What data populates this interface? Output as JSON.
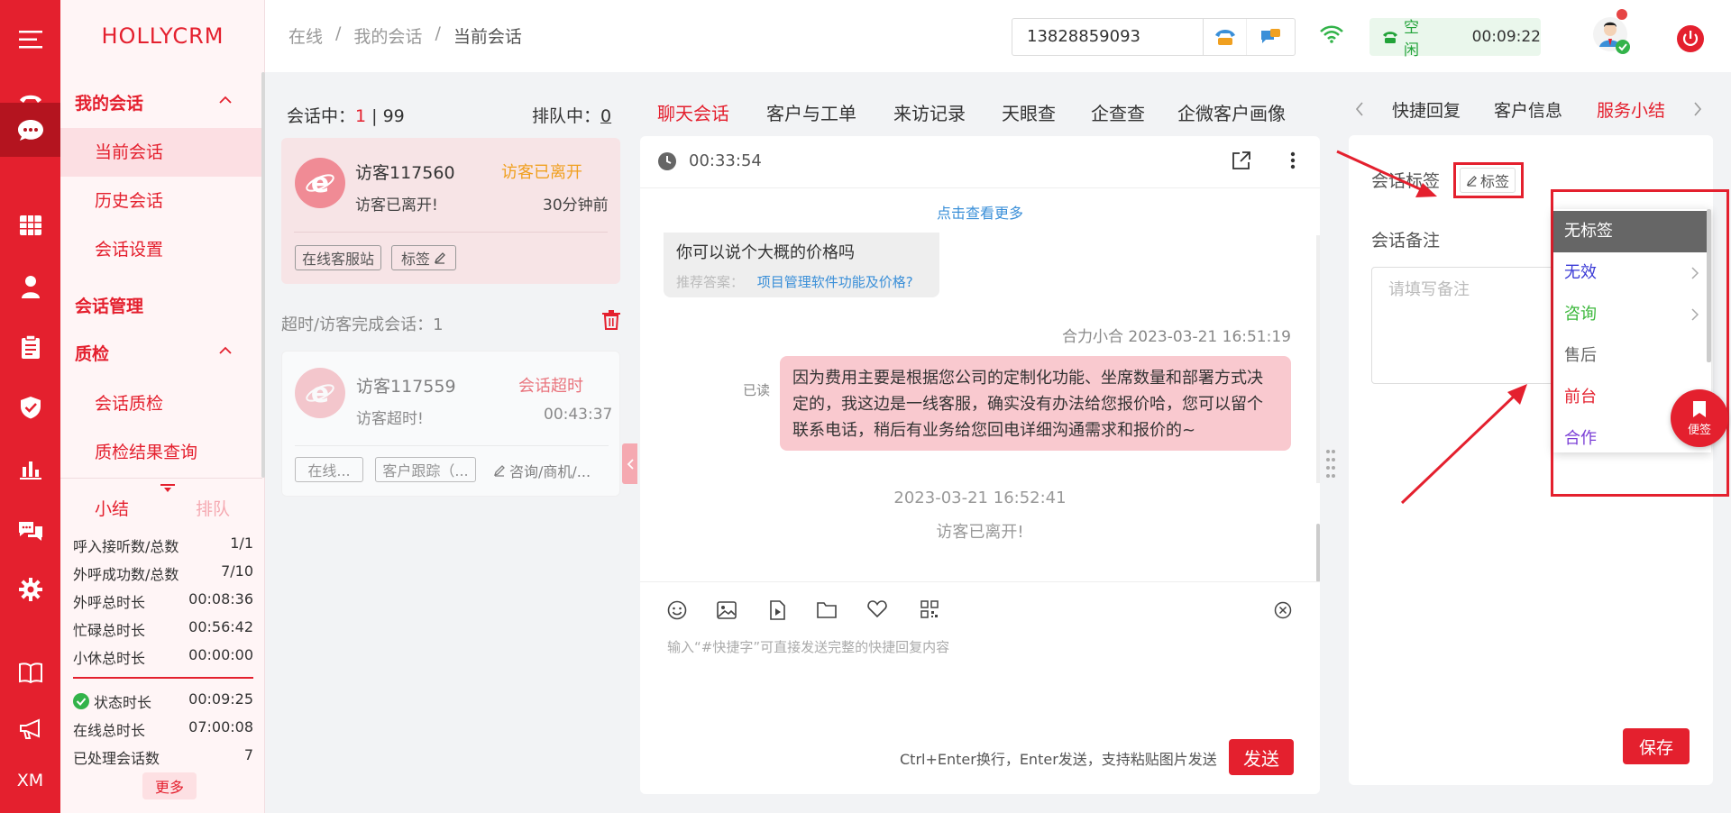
{
  "app": {
    "brand": "HOLLYCRM"
  },
  "rail": {
    "icons": [
      "menu-icon",
      "phone-icon",
      "chat-icon",
      "grid-icon",
      "user-icon",
      "clipboard-icon",
      "shield-icon",
      "bar-chart-icon",
      "comments-icon",
      "gear-icon",
      "book-icon",
      "megaphone-icon"
    ],
    "bottom_label": "XM",
    "accent": "#e4202e"
  },
  "nav": {
    "group_my_sessions": "我的会话",
    "current_session": "当前会话",
    "history_session": "历史会话",
    "session_settings": "会话设置",
    "session_management": "会话管理",
    "quality": "质检",
    "session_quality": "会话质检",
    "quality_results": "质检结果查询",
    "tab_summary": "小结",
    "tab_queue": "排队",
    "stats": [
      {
        "label": "呼入接听数/总数",
        "value": "1/1"
      },
      {
        "label": "外呼成功数/总数",
        "value": "7/10"
      },
      {
        "label": "外呼总时长",
        "value": "00:08:36"
      },
      {
        "label": "忙碌总时长",
        "value": "00:56:42"
      },
      {
        "label": "小休总时长",
        "value": "00:00:00"
      },
      {
        "label": "状态时长",
        "value": "00:09:25"
      },
      {
        "label": "在线总时长",
        "value": "07:00:08"
      },
      {
        "label": "已处理会话数",
        "value": "7"
      }
    ],
    "more": "更多"
  },
  "header": {
    "crumbs": [
      "在线",
      "我的会话",
      "当前会话"
    ],
    "sep": "/",
    "phone_value": "13828859093",
    "status": "空闲",
    "timer": "00:09:22"
  },
  "sessions": {
    "active_label": "会话中：",
    "active_count": "1",
    "active_sep": " | ",
    "active_total": "99",
    "queue_label": "排队中：",
    "queue_count": "0",
    "card1": {
      "name": "访客117560",
      "status": "访客已离开",
      "msg": "访客已离开!",
      "time": "30分钟前",
      "chip1": "在线客服站",
      "chip2": "标签"
    },
    "timeout_label": "超时/访客完成会话：1",
    "card2": {
      "name": "访客117559",
      "status": "会话超时",
      "msg": "访客超时!",
      "time": "00:43:37",
      "chip1": "在线...",
      "chip2": "客户跟踪（...",
      "chip3": "咨询/商机/..."
    }
  },
  "chat": {
    "tabs": [
      "聊天会话",
      "客户与工单",
      "来访记录",
      "天眼查",
      "企查查",
      "企微客户画像"
    ],
    "duration": "00:33:54",
    "load_more": "点击查看更多",
    "visitor_msg": "你可以说个大概的价格吗",
    "recommend_label": "推荐答案：",
    "recommend_link": "项目管理软件功能及价格?",
    "agent_header": "合力小合 2023-03-21 16:51:19",
    "read_label": "已读",
    "agent_msg": "因为费用主要是根据您公司的定制化功能、坐席数量和部署方式决定的，我这边是一线客服，确实没有办法给您报价哈，您可以留个联系电话，稍后有业务给您回电详细沟通需求和报价的~",
    "sys_time": "2023-03-21 16:52:41",
    "sys_msg": "访客已离开!",
    "toolbar_icons": [
      "emoji-icon",
      "image-icon",
      "video-icon",
      "folder-icon",
      "heart-icon",
      "qrcode-icon"
    ],
    "input_placeholder": "输入“#快捷字”可直接发送完整的快捷回复内容",
    "hint": "Ctrl+Enter换行，Enter发送，支持粘贴图片发送",
    "send": "发送"
  },
  "right": {
    "tabs": [
      "快捷回复",
      "客户信息",
      "服务小结"
    ],
    "tag_label": "会话标签",
    "tag_button": "标签",
    "note_label": "会话备注",
    "note_placeholder": "请填写备注",
    "save": "保存",
    "float_button": "便签",
    "dropdown": [
      {
        "label": "无标签",
        "color": "#ffffff"
      },
      {
        "label": "无效",
        "color": "#3b3bd6"
      },
      {
        "label": "咨询",
        "color": "#3cb83c"
      },
      {
        "label": "售后",
        "color": "#666666"
      },
      {
        "label": "前台",
        "color": "#e4202e"
      },
      {
        "label": "合作",
        "color": "#7b3fd6"
      }
    ]
  }
}
